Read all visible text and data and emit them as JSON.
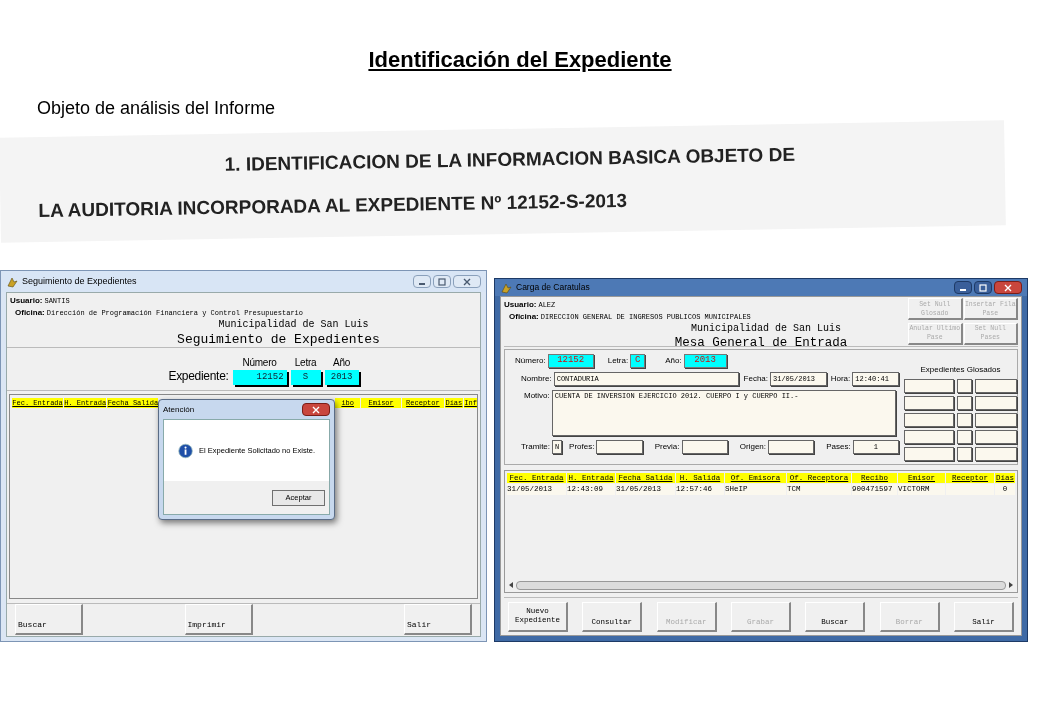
{
  "slide": {
    "title": "Identificación del Expediente",
    "subtitle": "Objeto de análisis del Informe"
  },
  "scan": {
    "lines": [
      "1. IDENTIFICACION DE LA INFORMACION BASICA OBJETO DE",
      "LA AUDITORIA INCORPORADA AL EXPEDIENTE Nº 12152-S-2013"
    ]
  },
  "seguimiento_window": {
    "title": "Seguimiento de Expedientes",
    "usuario_label": "Usuario:",
    "usuario": "SANTIS",
    "oficina_label": "Oficina:",
    "oficina": "Dirección de Programación Financiera y Control Presupuestario",
    "organization": "Municipalidad de San Luis",
    "heading": "Seguimiento de Expedientes",
    "expediente_label": "Expediente:",
    "fields": [
      {
        "label": "Número",
        "value": "12152"
      },
      {
        "label": "Letra",
        "value": "S"
      },
      {
        "label": "Año",
        "value": "2013"
      }
    ],
    "columns": [
      "Fec. Entrada",
      "H. Entrada",
      "Fecha Salida",
      "ibo",
      "Emisor",
      "Receptor",
      "Días",
      "Inf"
    ],
    "dialog": {
      "title": "Atención",
      "message": "El Expediente Solicitado no Existe.",
      "button": "Aceptar"
    },
    "buttons": [
      "Buscar",
      "Imprimir",
      "Salir"
    ]
  },
  "carga_window": {
    "title": "Carga de Caratulas",
    "usuario_label": "Usuario:",
    "usuario": "ALEZ",
    "oficina_label": "Oficina:",
    "oficina": "DIRECCION GENERAL DE INGRESOS PUBLICOS MUNICIPALES",
    "organization": "Municipalidad de San Luis",
    "heading": "Mesa General de Entrada",
    "top_buttons": [
      {
        "label": "Set Null Glosado",
        "disabled": true
      },
      {
        "label": "Insertar Fila Pase",
        "disabled": true
      },
      {
        "label": "Anular Ultimo Pase",
        "disabled": true
      },
      {
        "label": "Set Null Pases",
        "disabled": true
      }
    ],
    "numero": {
      "label": "Número:",
      "value": "12152"
    },
    "letra": {
      "label": "Letra:",
      "value": "C"
    },
    "anio": {
      "label": "Año:",
      "value": "2013"
    },
    "nombre": {
      "label": "Nombre:",
      "value": "CONTADURIA"
    },
    "fecha": {
      "label": "Fecha:",
      "value": "31/05/2013"
    },
    "hora": {
      "label": "Hora:",
      "value": "12:40:41"
    },
    "motivo": {
      "label": "Motivo:",
      "value": "CUENTA DE INVERSION EJERCICIO 2012. CUERPO I y CUERPO II.-"
    },
    "tramite": {
      "label": "Tramite:",
      "value": "N"
    },
    "profes": {
      "label": "Profes:"
    },
    "previa": {
      "label": "Previa:"
    },
    "origen": {
      "label": "Origen:"
    },
    "pases": {
      "label": "Pases:",
      "value": "1"
    },
    "glosados_title": "Expedientes Glosados",
    "columns": [
      "Fec. Entrada",
      "H. Entrada",
      "Fecha Salida",
      "H. Salida",
      "Of. Emisora",
      "Of. Receptora",
      "Recibo",
      "Emisor",
      "Receptor",
      "Días"
    ],
    "rows": [
      [
        "31/05/2013",
        "12:43:09",
        "31/05/2013",
        "12:57:46",
        "SHeIP",
        "TCM",
        "900471597",
        "VICTORM",
        null,
        "0"
      ]
    ],
    "buttons": [
      {
        "label": "Nuevo Expediente",
        "disabled": false
      },
      {
        "label": "Consultar",
        "disabled": false
      },
      {
        "label": "Modificar",
        "disabled": true
      },
      {
        "label": "Grabar",
        "disabled": true
      },
      {
        "label": "Buscar",
        "disabled": false
      },
      {
        "label": "Borrar",
        "disabled": true
      },
      {
        "label": "Salir",
        "disabled": false
      }
    ]
  }
}
